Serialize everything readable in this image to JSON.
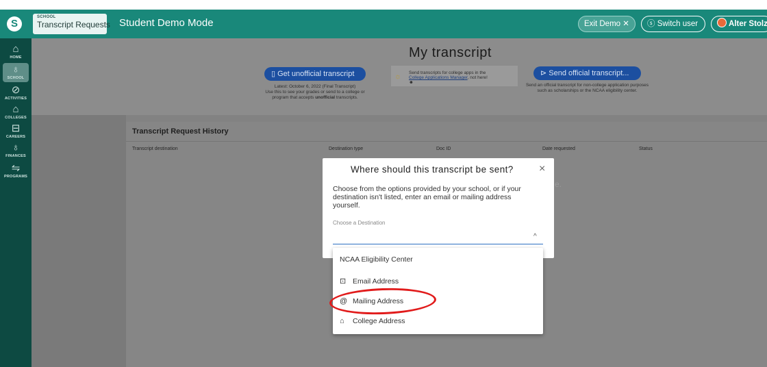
{
  "header": {
    "logo": "S",
    "school_small": "SCHOOL",
    "school_big": "Transcript Requests",
    "mode": "Student Demo Mode",
    "exit_demo": "Exit Demo ✕",
    "switch_user": "Switch user",
    "user_name": "Alter Stolz",
    "brand_color": "#19887a"
  },
  "sidebar": {
    "items": [
      {
        "label": "HOME",
        "icon": "home-icon",
        "glyph": "⌂"
      },
      {
        "label": "SCHOOL",
        "icon": "school-icon",
        "glyph": "♁"
      },
      {
        "label": "ACTIVITIES",
        "icon": "activities-icon",
        "glyph": "⊘"
      },
      {
        "label": "COLLEGES",
        "icon": "colleges-icon",
        "glyph": "⌂"
      },
      {
        "label": "CAREERS",
        "icon": "careers-icon",
        "glyph": "⊟"
      },
      {
        "label": "FINANCES",
        "icon": "finances-icon",
        "glyph": "♁"
      },
      {
        "label": "PROGRAMS",
        "icon": "programs-icon",
        "glyph": "⇋"
      }
    ]
  },
  "transcript": {
    "title": "My transcript",
    "unofficial_btn": "Get unofficial transcript",
    "unofficial_note_line1": "Latest: October 6, 2022 (Final Transcript)",
    "unofficial_note_line2": "Use this to see your grades or send to a college or",
    "unofficial_note_line3a": "program that accepts ",
    "unofficial_note_bold": "unofficial",
    "unofficial_note_line3b": " transcripts.",
    "middle_line1": "Send transcripts for college apps in the",
    "middle_link": "College Applications Manager",
    "middle_line2b": ", not here!",
    "official_btn": "Send official transcript...",
    "official_note": "Send an official transcript for non-college application purposes such as scholarships or the NCAA eligibility center."
  },
  "history": {
    "title": "Transcript Request History",
    "columns": [
      "Transcript destination",
      "Destination type",
      "Doc ID",
      "Date requested",
      "Status"
    ],
    "ghost_text": "e."
  },
  "modal": {
    "title": "Where should this transcript be sent?",
    "close": "×",
    "body": "Choose from the options provided by your school, or if your destination isn't listed, enter an email or mailing address yourself.",
    "field_label": "Choose a Destination",
    "options": [
      {
        "label": "NCAA Eligibility Center",
        "icon": ""
      },
      {
        "label": "Email Address",
        "icon": "email-icon"
      },
      {
        "label": "Mailing Address",
        "icon": "mailing-icon"
      },
      {
        "label": "College Address",
        "icon": "college-icon"
      }
    ],
    "highlight_color": "#e11b1b"
  }
}
